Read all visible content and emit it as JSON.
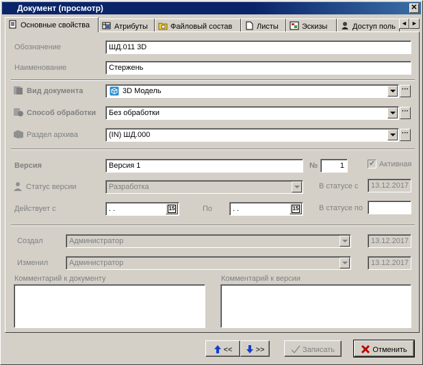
{
  "window": {
    "title": "Документ (просмотр)",
    "close_glyph": "✕"
  },
  "tabs": [
    {
      "label": "Основные свойства",
      "icon": "document-properties-icon"
    },
    {
      "label": "Атрибуты",
      "icon": "attributes-table-icon"
    },
    {
      "label": "Файловый состав",
      "icon": "folder-files-icon"
    },
    {
      "label": "Листы",
      "icon": "sheet-icon"
    },
    {
      "label": "Эскизы",
      "icon": "sketch-icon"
    },
    {
      "label": "Доступ поль",
      "icon": "user-access-icon"
    }
  ],
  "tab_scroll": {
    "left": "◄",
    "right": "►"
  },
  "form": {
    "designation": {
      "label": "Обозначение",
      "value": "ШД.011 3D"
    },
    "name": {
      "label": "Наименование",
      "value": "Стержень"
    },
    "doc_type": {
      "label": "Вид документа",
      "value": "3D Модель",
      "icon": "3d-model-cube-icon"
    },
    "processing": {
      "label": "Способ обработки",
      "value": "Без обработки"
    },
    "archive": {
      "label": "Раздел архива",
      "value": "(IN) ШД.000"
    },
    "dots": "···",
    "version": {
      "label": "Версия",
      "value": "Версия 1",
      "no_label": "№",
      "no_value": "1"
    },
    "active": {
      "label": "Активная",
      "checked": true,
      "check_glyph": "✔"
    },
    "version_status": {
      "label": "Статус версии",
      "value": "Разработка"
    },
    "in_status_since": {
      "label": "В статусе с",
      "value": "13.12.2017"
    },
    "valid_from": {
      "label": "Действует с",
      "value": " .  ."
    },
    "valid_to": {
      "label": "По",
      "value": " .  ."
    },
    "in_status_until": {
      "label": "В статусе по",
      "value": ""
    },
    "calendar_glyph": "15",
    "created": {
      "label": "Создал",
      "value": "Администратор",
      "date": "13.12.2017"
    },
    "modified": {
      "label": "Изменил",
      "value": "Администратор",
      "date": "13.12.2017"
    },
    "doc_comment": {
      "label": "Комментарий к документу",
      "value": ""
    },
    "version_comment": {
      "label": "Комментарий к версии",
      "value": ""
    }
  },
  "buttons": {
    "prev": "<<",
    "next": ">>",
    "save": "Записать",
    "cancel": "Отменить"
  },
  "colors": {
    "face": "#d4d0c8",
    "title_bar": "#0a246a",
    "disabled_text": "#808080",
    "nav_arrow": "#1040d0",
    "cancel_x": "#c00000"
  }
}
